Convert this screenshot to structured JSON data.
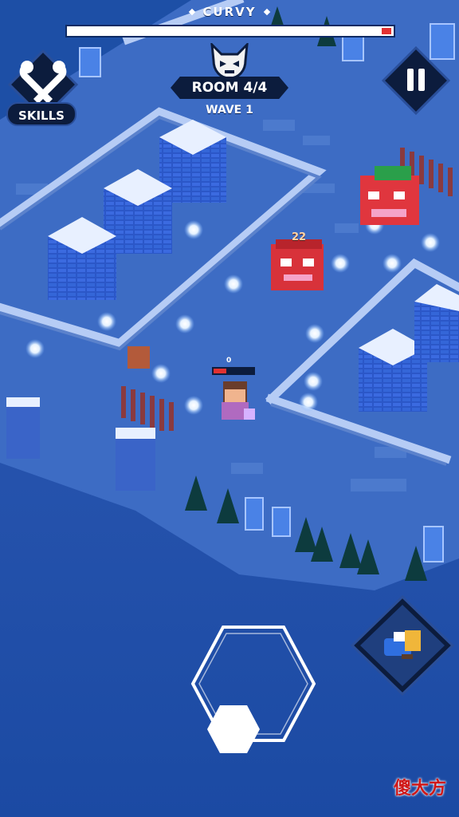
{
  "boss": {
    "name": "CURVY",
    "health_fraction": 0.03
  },
  "hud": {
    "skills_label": "SKILLS",
    "room_label": "ROOM 4/4",
    "wave_label": "WAVE 1"
  },
  "player": {
    "hp_value": "0"
  },
  "enemy": {
    "damage_text": "22"
  },
  "watermark": "傻大方",
  "colors": {
    "background": "#1d4fa6",
    "floor": "#3f6fc6",
    "wall": "#8fb0ec",
    "pillar": "#2a54c6",
    "snow": "#e8f0ff",
    "boss_health": "#e23232",
    "enemy": "#d8323a",
    "projectile": "#ffffff"
  },
  "icons": {
    "skills": "crossed-axes-icon",
    "room": "demon-skull-icon",
    "pause": "pause-icon",
    "ability": "gauntlet-icon"
  }
}
